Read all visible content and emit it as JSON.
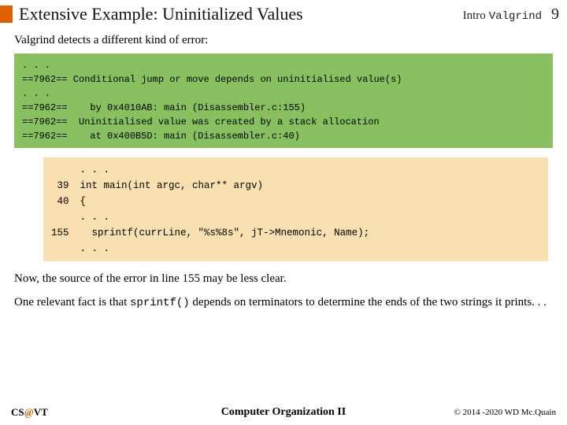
{
  "header": {
    "title": "Extensive Example:  Uninitialized Values",
    "right_label": "Intro",
    "right_mono": "Valgrind",
    "page_num": "9"
  },
  "intro": "Valgrind detects a different kind of error:",
  "valgrind_output": ". . .\n==7962== Conditional jump or move depends on uninitialised value(s)\n. . .\n==7962==    by 0x4010AB: main (Disassembler.c:155)\n==7962==  Uninitialised value was created by a stack allocation\n==7962==    at 0x400B5D: main (Disassembler.c:40)",
  "code_block": {
    "linenos": "\n39\n40\n\n155\n",
    "code": ". . .\nint main(int argc, char** argv)\n{\n. . .\n  sprintf(currLine, \"%s%8s\", jT->Mnemonic, Name);\n. . ."
  },
  "para1": "Now, the source of the error in line 155 may be less clear.",
  "para2_prefix": "One relevant fact is that ",
  "para2_mono": "sprintf()",
  "para2_suffix": " depends on terminators to determine the ends of the two strings it prints. . .",
  "footer": {
    "left_cs": "CS",
    "left_at": "@",
    "left_vt": "VT",
    "center": "Computer Organization II",
    "right": "© 2014 -2020 WD Mc.Quain"
  }
}
